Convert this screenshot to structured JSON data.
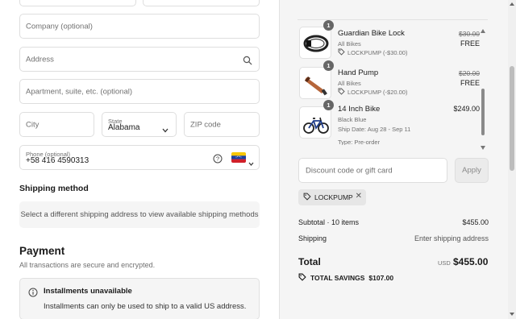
{
  "form": {
    "company_placeholder": "Company (optional)",
    "address_placeholder": "Address",
    "apartment_placeholder": "Apartment, suite, etc. (optional)",
    "city_placeholder": "City",
    "state_label": "State",
    "state_value": "Alabama",
    "zip_placeholder": "ZIP code",
    "phone_label": "Phone (optional)",
    "phone_value": "+58 416 4590313"
  },
  "shipping": {
    "heading": "Shipping method",
    "message": "Select a different shipping address to view available shipping methods"
  },
  "payment": {
    "heading": "Payment",
    "subtitle": "All transactions are secure and encrypted.",
    "installments_title": "Installments unavailable",
    "installments_message": "Installments can only be used to ship to a valid US address."
  },
  "cart": {
    "items": [
      {
        "qty": "1",
        "name": "Guardian Bike Lock",
        "category": "All Bikes",
        "discount": "LOCKPUMP (-$30.00)",
        "old_price": "$30.00",
        "price": "FREE",
        "icon": "bike-lock-image"
      },
      {
        "qty": "1",
        "name": "Hand Pump",
        "category": "All Bikes",
        "discount": "LOCKPUMP (-$20.00)",
        "old_price": "$20.00",
        "price": "FREE",
        "icon": "hand-pump-image"
      },
      {
        "qty": "1",
        "name": "14 Inch Bike",
        "variant": "Black Blue",
        "ship_date": "Ship Date: Aug 28 - Sep 11",
        "type": "Type: Pre-order",
        "price": "$249.00",
        "icon": "bicycle-image"
      }
    ],
    "discount_placeholder": "Discount code or gift card",
    "apply_label": "Apply",
    "applied_code": "LOCKPUMP",
    "subtotal_label": "Subtotal · 10 items",
    "subtotal_value": "$455.00",
    "shipping_label": "Shipping",
    "shipping_value": "Enter shipping address",
    "total_label": "Total",
    "total_currency": "USD",
    "total_value": "$455.00",
    "savings_label": "TOTAL SAVINGS",
    "savings_value": "$107.00"
  },
  "colors": {
    "summary_bg": "#f5f5f5",
    "border": "#dedede",
    "muted_text": "#707070"
  }
}
